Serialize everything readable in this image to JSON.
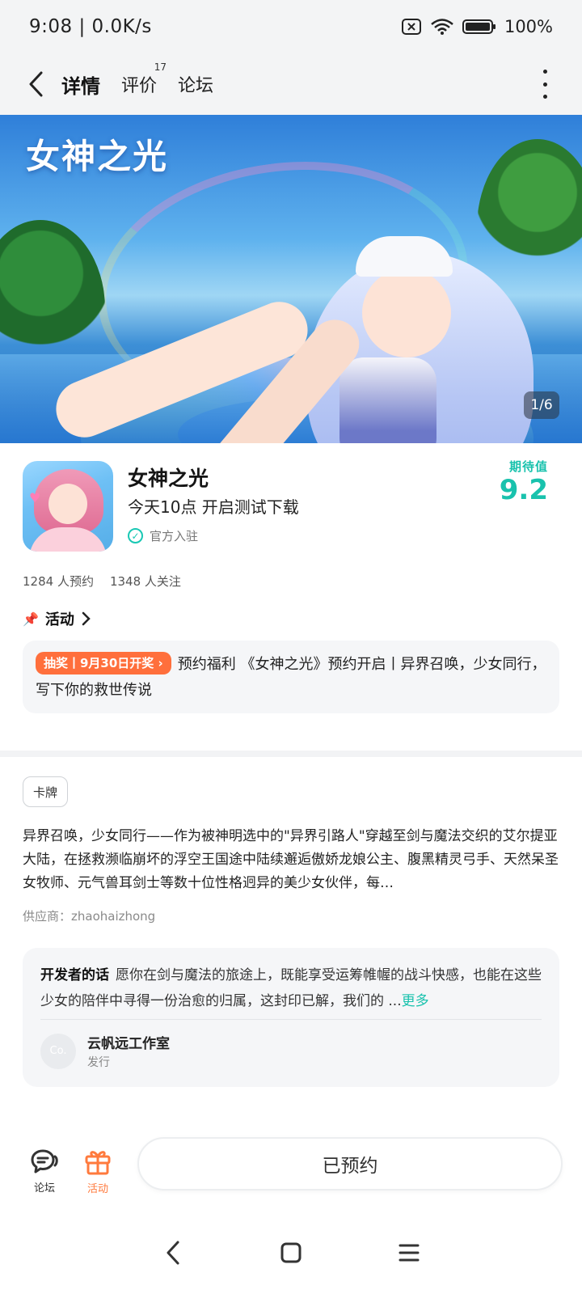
{
  "status_bar": {
    "time": "9:08 | 0.0K/s",
    "battery": "100%"
  },
  "nav": {
    "tabs": [
      {
        "label": "详情",
        "active": true
      },
      {
        "label": "评价",
        "badge": "17"
      },
      {
        "label": "论坛"
      }
    ]
  },
  "banner": {
    "title": "女神之光",
    "counter": "1/6"
  },
  "app": {
    "name": "女神之光",
    "subtitle": "今天10点 开启测试下载",
    "official": "官方入驻",
    "score_label": "期待值",
    "score_value": "9.2",
    "reservations": "1284 人预约",
    "followers": "1348 人关注"
  },
  "activity": {
    "heading": "活动",
    "tag": "抽奖丨9月30日开奖",
    "text": "预约福利 《女神之光》预约开启丨异界召唤，少女同行，写下你的救世传说"
  },
  "description": {
    "tag": "卡牌",
    "text": "异界召唤，少女同行——作为被神明选中的\"异界引路人\"穿越至剑与魔法交织的艾尔提亚大陆，在拯救濒临崩坏的浮空王国途中陆续邂逅傲娇龙娘公主、腹黑精灵弓手、天然呆圣女牧师、元气兽耳剑士等数十位性格迥异的美少女伙伴，每…",
    "supplier": "供应商：zhaohaizhong"
  },
  "developer": {
    "heading": "开发者的话",
    "words": "愿你在剑与魔法的旅途上，既能享受运筹帷幄的战斗快感，也能在这些少女的陪伴中寻得一份治愈的归属，这封印已解，我们的 ...",
    "more": "更多",
    "studio": "云帆远工作室",
    "role": "发行",
    "avatar_text": "Co."
  },
  "action_bar": {
    "forum": "论坛",
    "activity": "活动",
    "reserve": "已预约"
  },
  "colors": {
    "accent": "#19c2ad",
    "orange": "#ff6f3c"
  },
  "icons": [
    "back-arrow-icon",
    "more-vertical-icon",
    "check-circle-icon",
    "pin-icon",
    "chevron-right-icon",
    "forum-icon",
    "gift-icon",
    "nav-back-icon",
    "nav-home-icon",
    "nav-menu-icon",
    "wifi-icon",
    "battery-icon",
    "sim-off-icon"
  ]
}
